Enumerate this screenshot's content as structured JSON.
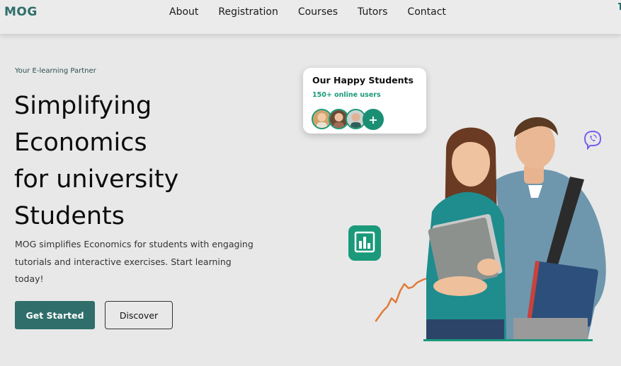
{
  "brand": {
    "logo": "MOG"
  },
  "nav": {
    "items": [
      "About",
      "Registration",
      "Courses",
      "Tutors",
      "Contact"
    ]
  },
  "hero": {
    "tagline": "Your E-learning Partner",
    "headline": [
      "Simplifying",
      "Economics",
      "for university",
      "Students"
    ],
    "description": "MOG simplifies Economics for students with engaging tutorials and interactive exercises. Start learning today!",
    "primary_button": "Get Started",
    "secondary_button": "Discover"
  },
  "students_card": {
    "title": "Our Happy Students",
    "subtitle": "150+ online users",
    "plus": "+"
  },
  "icons": {
    "chart_badge": "bar-chart-icon",
    "viber": "viber-icon",
    "plus": "plus-icon"
  },
  "colors": {
    "brand": "#2f6e6a",
    "accent": "#1a9a7a",
    "background": "#e8e8e8",
    "viber": "#7360f2",
    "squiggle": "#e07b3a"
  }
}
